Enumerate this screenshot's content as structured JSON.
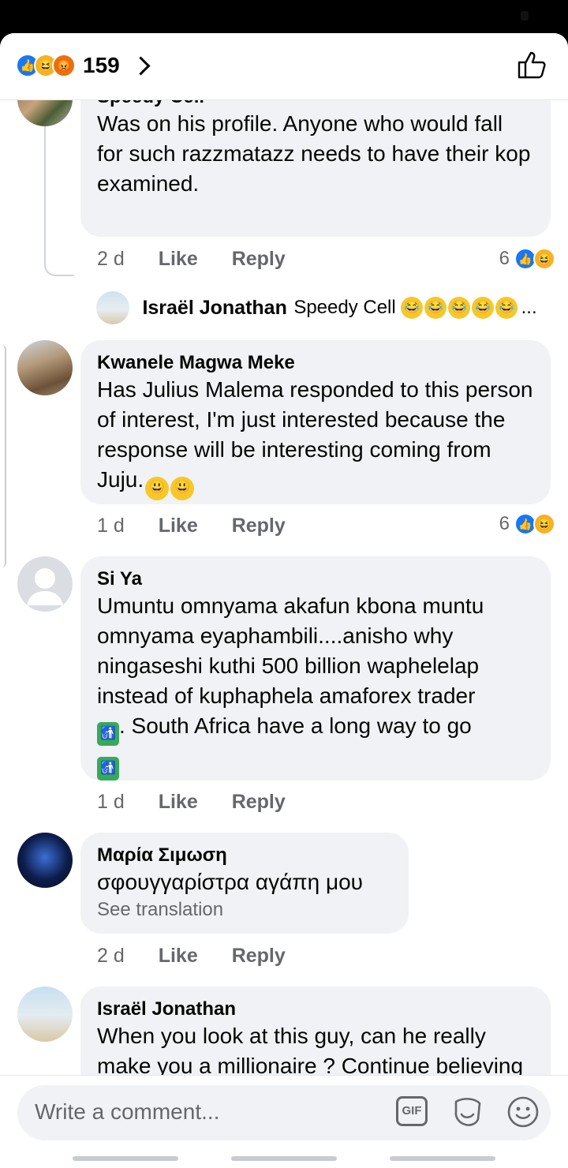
{
  "header": {
    "reaction_count": "159",
    "reaction_icons": [
      "like-icon",
      "haha-icon",
      "angry-icon"
    ]
  },
  "comments": [
    {
      "author": "Speedy Cell",
      "text": "Was on his profile. Anyone who would fall for such razzmatazz needs to have their kop examined.",
      "time": "2 d",
      "like": "Like",
      "reply": "Reply",
      "reaction_count": "6",
      "reply_preview": {
        "author": "Israël Jonathan",
        "text": "Speedy Cell",
        "ellipsis": "..."
      }
    },
    {
      "author": "Kwanele Magwa Meke",
      "text": "Has Julius Malema responded to this person of interest, I'm just interested because the response will be interesting coming from Juju.",
      "time": "1 d",
      "like": "Like",
      "reply": "Reply",
      "reaction_count": "6"
    },
    {
      "author": "Si Ya",
      "text_line_1": "Umuntu omnyama akafun kbona muntu omnyama eyaphambili....anisho why ningaseshi kuthi 500 billion waphelelap instead of kuphaphela amaforex trader",
      "text_line_2": ". South Africa have a long way to go",
      "time": "1 d",
      "like": "Like",
      "reply": "Reply"
    },
    {
      "author": "Μαρία Σιμωση",
      "text": "σφουγγαρίστρα αγάπη μου",
      "see_translation": "See translation",
      "time": "2 d",
      "like": "Like",
      "reply": "Reply"
    },
    {
      "author": "Israël Jonathan",
      "text": "When you look at this guy, can he really make you a millionaire ? Continue believing these people, you will continue"
    }
  ],
  "footer": {
    "placeholder": "Write a comment...",
    "gif_label": "GIF"
  },
  "colors": {
    "accent": "#1877f2",
    "bubble": "#f0f2f5",
    "secondary_text": "#65676b"
  }
}
